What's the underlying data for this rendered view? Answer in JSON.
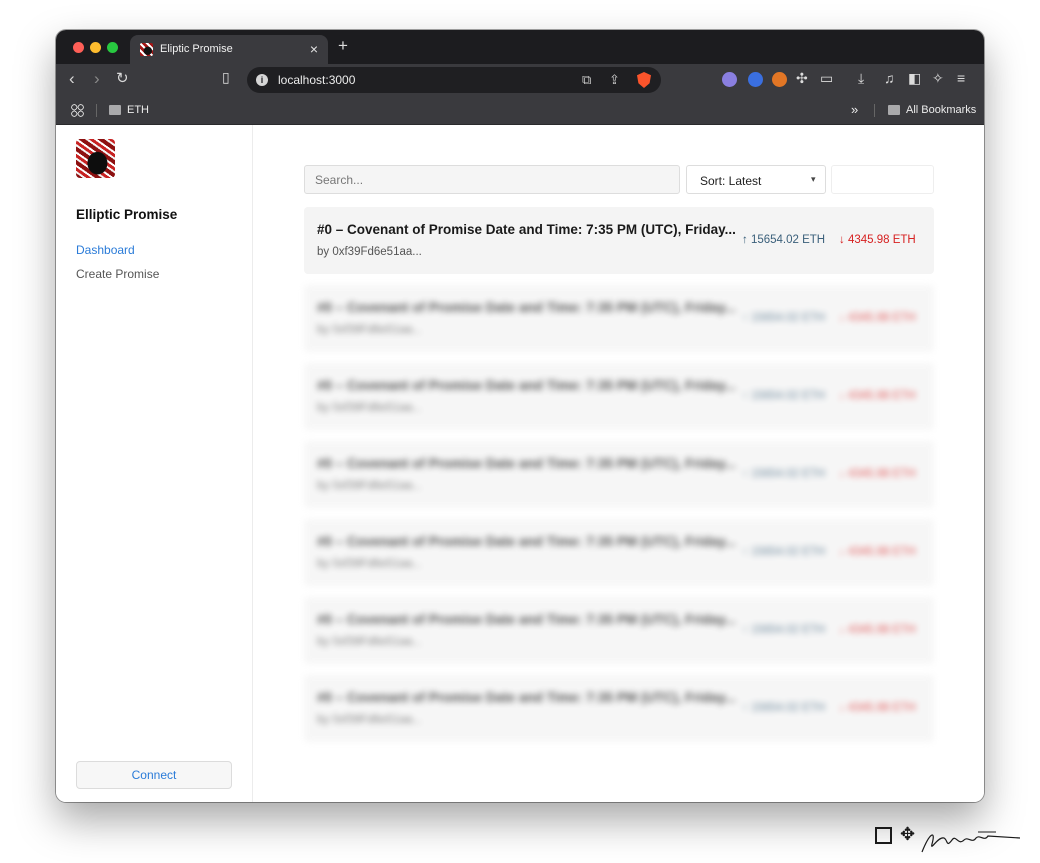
{
  "browser": {
    "tab_title": "Eliptic Promise",
    "tab_close": "×",
    "new_tab": "+",
    "url": "localhost:3000",
    "bookmarks": [
      {
        "label": "ETH"
      }
    ],
    "bookmarks_overflow": "»",
    "all_bookmarks": "All Bookmarks"
  },
  "sidebar": {
    "brand": "Elliptic Promise",
    "nav": [
      {
        "label": "Dashboard",
        "active": true
      },
      {
        "label": "Create Promise",
        "active": false
      }
    ],
    "connect_label": "Connect"
  },
  "controls": {
    "search_placeholder": "Search...",
    "sort_label": "Sort: Latest",
    "sort_chevron": "▾"
  },
  "promises": [
    {
      "title": "#0 – Covenant of Promise Date and Time: 7:35 PM (UTC), Friday...",
      "author": "by 0xf39Fd6e51aa...",
      "up": "15654.02 ETH",
      "down": "4345.98 ETH",
      "blurred": false
    },
    {
      "title": "#0 – Covenant of Promise Date and Time: 7:35 PM (UTC), Friday...",
      "author": "by 0xf39Fd6e51aa...",
      "up": "15654.02 ETH",
      "down": "4345.98 ETH",
      "blurred": true
    },
    {
      "title": "#0 – Covenant of Promise Date and Time: 7:35 PM (UTC), Friday...",
      "author": "by 0xf39Fd6e51aa...",
      "up": "15654.02 ETH",
      "down": "4345.98 ETH",
      "blurred": true
    },
    {
      "title": "#0 – Covenant of Promise Date and Time: 7:35 PM (UTC), Friday...",
      "author": "by 0xf39Fd6e51aa...",
      "up": "15654.02 ETH",
      "down": "4345.98 ETH",
      "blurred": true
    },
    {
      "title": "#0 – Covenant of Promise Date and Time: 7:35 PM (UTC), Friday...",
      "author": "by 0xf39Fd6e51aa...",
      "up": "15654.02 ETH",
      "down": "4345.98 ETH",
      "blurred": true
    },
    {
      "title": "#0 – Covenant of Promise Date and Time: 7:35 PM (UTC), Friday...",
      "author": "by 0xf39Fd6e51aa...",
      "up": "15654.02 ETH",
      "down": "4345.98 ETH",
      "blurred": true
    },
    {
      "title": "#0 – Covenant of Promise Date and Time: 7:35 PM (UTC), Friday...",
      "author": "by 0xf39Fd6e51aa...",
      "up": "15654.02 ETH",
      "down": "4345.98 ETH",
      "blurred": true
    }
  ],
  "arrows": {
    "up": "↑",
    "down": "↓"
  },
  "colors": {
    "accent": "#2a7bd8",
    "up": "#3a5f7a",
    "down": "#d61f1f",
    "chrome_dark": "#1c1c1f",
    "chrome_toolbar": "#3a3a3e"
  }
}
